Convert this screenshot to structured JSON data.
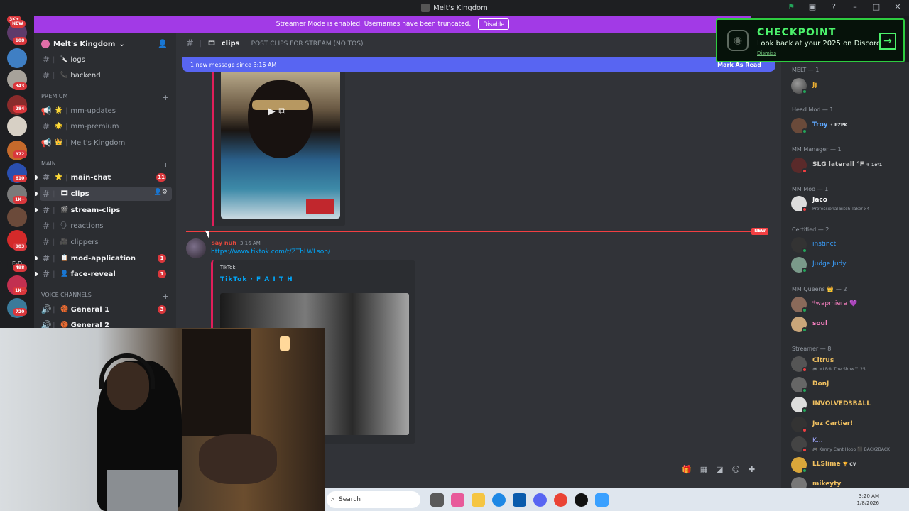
{
  "window": {
    "title": "Melt's Kingdom"
  },
  "banner": {
    "text": "Streamer Mode is enabled. Usernames have been truncated.",
    "disable_label": "Disable"
  },
  "checkpoint": {
    "title": "CHECKPOINT",
    "subtitle": "Look back at your 2025 on Discord",
    "dismiss": "Dismiss"
  },
  "rail": {
    "badges": [
      "NEW",
      "108",
      "343",
      "284",
      "972",
      "610",
      "1K+",
      "983",
      "498",
      "1K+",
      "720"
    ],
    "mention_label": "3K+",
    "folder_label": "E-D"
  },
  "server": {
    "name": "Melt's Kingdom"
  },
  "sidebar": {
    "premium_category": "PREMIUM",
    "main_category": "MAIN",
    "voice_category": "VOICE CHANNELS",
    "channels": [
      {
        "name": "logs",
        "emoji": "🔪"
      },
      {
        "name": "backend",
        "emoji": "📞"
      },
      {
        "name": "mm-updates",
        "emoji": "🌟"
      },
      {
        "name": "mm-premium",
        "emoji": "🌟"
      },
      {
        "name": "Melt's Kingdom",
        "emoji": "👑"
      },
      {
        "name": "main-chat",
        "emoji": "⭐",
        "badge": "11"
      },
      {
        "name": "clips",
        "emoji": "🎞"
      },
      {
        "name": "stream-clips",
        "emoji": "🎬"
      },
      {
        "name": "reactions",
        "emoji": "🗣"
      },
      {
        "name": "clippers",
        "emoji": "🎥"
      },
      {
        "name": "mod-application",
        "emoji": "📋",
        "badge": "1"
      },
      {
        "name": "face-reveal",
        "emoji": "👤",
        "badge": "1"
      }
    ],
    "voice_channels": [
      {
        "name": "General 1",
        "badge": "3"
      },
      {
        "name": "General 2"
      }
    ]
  },
  "header": {
    "channel": "clips",
    "topic": "POST CLIPS FOR STREAM (NO TOS)"
  },
  "messages": {
    "new_since": "1 new message since 3:16 AM",
    "mark_read": "Mark As Read",
    "new_tag": "NEW",
    "author": "say nuh",
    "time": "3:16 AM",
    "link": "https://www.tiktok.com/t/ZThLWLsoh/",
    "embed_provider": "TikTok",
    "embed_title": "TikTok · F A I T H"
  },
  "members": {
    "groups": [
      {
        "role": "MELT — 1",
        "members": [
          {
            "name": "Jj",
            "color": "#f0b232"
          }
        ]
      },
      {
        "role": "Head Mod — 1",
        "members": [
          {
            "name": "Troy",
            "color": "#5fa8ff",
            "tag": "⚡ PZPK"
          }
        ]
      },
      {
        "role": "MM Manager — 1",
        "members": [
          {
            "name": "SLG laterall °F",
            "color": "#c9c9c9",
            "tag": "❄ 1of1"
          }
        ]
      },
      {
        "role": "MM Mod — 1",
        "members": [
          {
            "name": "Jaco",
            "color": "#ffffff",
            "sub": "Professional Bitch Taker x4"
          }
        ]
      },
      {
        "role": "Certified — 2",
        "members": [
          {
            "name": "instinct",
            "color": "#3aa0ff"
          },
          {
            "name": "Judge Judy",
            "color": "#3aa0ff"
          }
        ]
      },
      {
        "role": "MM Queens 👑 — 2",
        "members": [
          {
            "name": "*wapmiera 💜",
            "color": "#f57fbf"
          },
          {
            "name": "soul",
            "color": "#f57fbf"
          }
        ]
      },
      {
        "role": "Streamer — 8",
        "members": [
          {
            "name": "Citrus",
            "color": "#f0c060",
            "sub": "🎮 MLB® The Show™ 25"
          },
          {
            "name": "DonJ",
            "color": "#f0c060"
          },
          {
            "name": "INVOLVED3BALL",
            "color": "#f0c060"
          },
          {
            "name": "Juz Cartier!",
            "color": "#f0c060"
          },
          {
            "name": "K...",
            "color": "#f0c060",
            "sub": "🎮 Kenny Cant Hoop ⬛ BACK2BACK"
          },
          {
            "name": "LLSlime",
            "color": "#f0c060",
            "tag": "🏆 CV"
          },
          {
            "name": "mikeyty",
            "color": "#f0c060"
          }
        ]
      }
    ]
  },
  "taskbar": {
    "search_placeholder": "Search",
    "time": "3:20 AM",
    "date": "1/8/2026"
  },
  "colors": {
    "accent": "#5865f2",
    "banner": "#a23ae6",
    "checkpoint": "#4cf26b",
    "danger": "#da373c"
  }
}
